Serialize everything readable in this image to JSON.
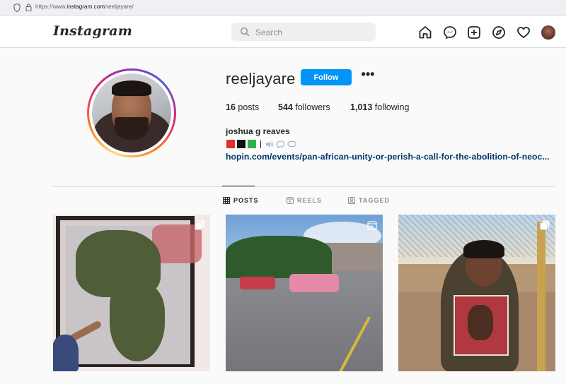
{
  "browser": {
    "url_prefix": "https://www.",
    "url_host": "instagram.com",
    "url_path": "/reeljayare/"
  },
  "header": {
    "logo": "Instagram",
    "search_placeholder": "Search",
    "nav_icons": [
      "home-icon",
      "messenger-icon",
      "new-post-icon",
      "explore-icon",
      "activity-heart-icon",
      "profile-avatar"
    ]
  },
  "profile": {
    "username": "reeljayare",
    "follow_label": "Follow",
    "more_label": "•••",
    "stats": {
      "posts_count": "16",
      "posts_label": "posts",
      "followers_count": "544",
      "followers_label": "followers",
      "following_count": "1,013",
      "following_label": "following"
    },
    "full_name": "joshua g reaves",
    "bio_squares": [
      "#e0302a",
      "#111111",
      "#2cb34a"
    ],
    "bio_separator": "|",
    "link": "hopin.com/events/pan-african-unity-or-perish-a-call-for-the-abolition-of-neoc..."
  },
  "tabs": [
    {
      "label": "POSTS",
      "icon": "grid-icon",
      "active": true
    },
    {
      "label": "REELS",
      "icon": "reels-icon",
      "active": false
    },
    {
      "label": "TAGGED",
      "icon": "tagged-icon",
      "active": false
    }
  ],
  "colors": {
    "accent": "#0095f6",
    "link": "#00376b",
    "text": "#262626",
    "muted": "#8e8e8e"
  }
}
